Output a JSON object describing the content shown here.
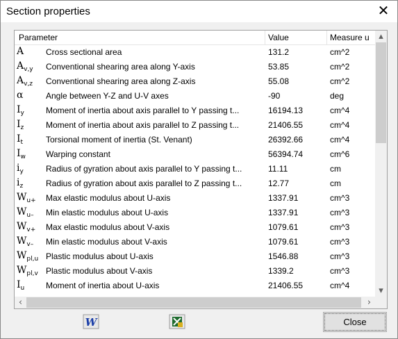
{
  "window": {
    "title": "Section properties"
  },
  "table": {
    "columns": [
      "Parameter",
      "Value",
      "Measure u"
    ],
    "rows": [
      {
        "sym": "A",
        "sub": "",
        "desc": "Cross sectional area",
        "value": "131.2",
        "unit": "cm^2"
      },
      {
        "sym": "A",
        "sub": "v,y",
        "desc": "Conventional shearing area along Y-axis",
        "value": "53.85",
        "unit": "cm^2"
      },
      {
        "sym": "A",
        "sub": "v,z",
        "desc": "Conventional shearing area along Z-axis",
        "value": "55.08",
        "unit": "cm^2"
      },
      {
        "sym": "α",
        "sub": "",
        "desc": "Angle between Y-Z and U-V axes",
        "value": "-90",
        "unit": "deg"
      },
      {
        "sym": "I",
        "sub": "y",
        "desc": "Moment of inertia about axis parallel to Y passing t...",
        "value": "16194.13",
        "unit": "cm^4"
      },
      {
        "sym": "I",
        "sub": "z",
        "desc": "Moment of inertia about axis parallel to Z passing t...",
        "value": "21406.55",
        "unit": "cm^4"
      },
      {
        "sym": "I",
        "sub": "t",
        "desc": "Torsional moment of inertia (St. Venant)",
        "value": "26392.66",
        "unit": "cm^4"
      },
      {
        "sym": "I",
        "sub": "w",
        "desc": "Warping constant",
        "value": "56394.74",
        "unit": "cm^6"
      },
      {
        "sym": "i",
        "sub": "y",
        "desc": "Radius of gyration about axis parallel to Y passing t...",
        "value": "11.11",
        "unit": "cm"
      },
      {
        "sym": "i",
        "sub": "z",
        "desc": "Radius of gyration about axis parallel to Z passing t...",
        "value": "12.77",
        "unit": "cm"
      },
      {
        "sym": "W",
        "sub": "u+",
        "desc": "Max elastic modulus about U-axis",
        "value": "1337.91",
        "unit": "cm^3"
      },
      {
        "sym": "W",
        "sub": "u–",
        "desc": "Min elastic modulus about U-axis",
        "value": "1337.91",
        "unit": "cm^3"
      },
      {
        "sym": "W",
        "sub": "v+",
        "desc": "Max elastic modulus about V-axis",
        "value": "1079.61",
        "unit": "cm^3"
      },
      {
        "sym": "W",
        "sub": "v–",
        "desc": "Min elastic modulus about V-axis",
        "value": "1079.61",
        "unit": "cm^3"
      },
      {
        "sym": "W",
        "sub": "pl,u",
        "desc": "Plastic modulus about U-axis",
        "value": "1546.88",
        "unit": "cm^3"
      },
      {
        "sym": "W",
        "sub": "pl,v",
        "desc": "Plastic modulus about V-axis",
        "value": "1339.2",
        "unit": "cm^3"
      },
      {
        "sym": "I",
        "sub": "u",
        "desc": "Moment of inertia about U-axis",
        "value": "21406.55",
        "unit": "cm^4"
      }
    ]
  },
  "buttons": {
    "close_label": "Close"
  },
  "icons": {
    "window_close": "close-icon",
    "word_export": "word-export-icon",
    "excel_export": "excel-export-icon"
  }
}
